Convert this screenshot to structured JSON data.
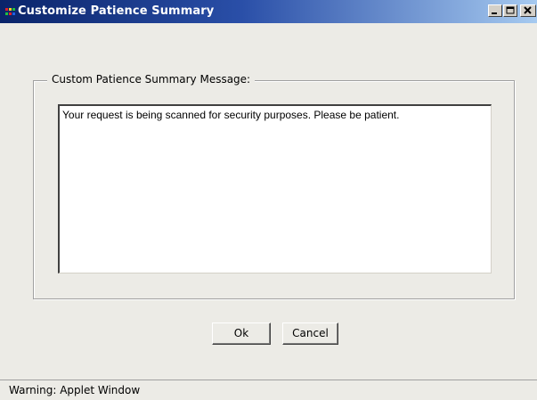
{
  "window": {
    "title": "Customize Patience Summary",
    "controls": {
      "minimize_icon": "minimize-icon",
      "maximize_icon": "maximize-icon",
      "close_icon": "close-icon"
    }
  },
  "group": {
    "legend": "Custom Patience Summary Message:"
  },
  "message_field": {
    "value": "Your request is being scanned for security purposes. Please be patient."
  },
  "buttons": {
    "ok_label": "Ok",
    "cancel_label": "Cancel"
  },
  "status": {
    "text": "Warning: Applet Window"
  },
  "colors": {
    "titlebar_start": "#0a246a",
    "titlebar_end": "#a6caf0",
    "window_bg": "#ecebe6"
  }
}
